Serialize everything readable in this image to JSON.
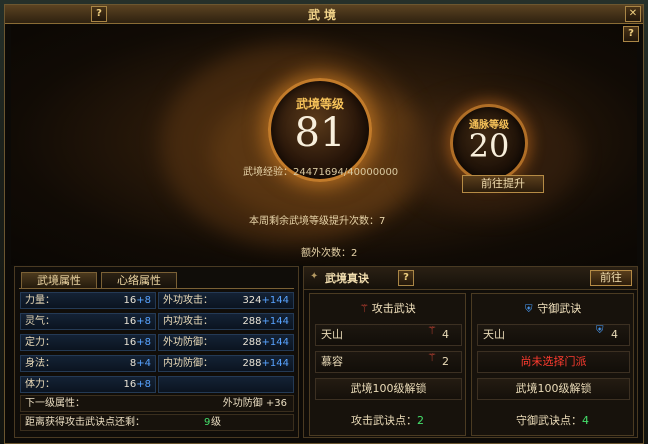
{
  "window": {
    "title": "武境",
    "help": "?",
    "close": "✕"
  },
  "outer_help": "?",
  "level": {
    "title": "武境等级",
    "value": "81"
  },
  "meridian": {
    "title": "通脉等级",
    "value": "20"
  },
  "exp": {
    "label": "武境经验：",
    "value": "24471694/40000000"
  },
  "goto_upgrade": "前往提升",
  "weekly": {
    "label": "本周剩余武境等级提升次数：",
    "value": "7"
  },
  "extra": {
    "label": "额外次数：",
    "value": "2"
  },
  "tabs": {
    "attr": "武境属性",
    "meridian": "心络属性"
  },
  "attributes": [
    {
      "name": "力量：",
      "base": "16",
      "plus": "+8",
      "name2": "外功攻击：",
      "base2": "324",
      "plus2": "+144"
    },
    {
      "name": "灵气：",
      "base": "16",
      "plus": "+8",
      "name2": "内功攻击：",
      "base2": "288",
      "plus2": "+144"
    },
    {
      "name": "定力：",
      "base": "16",
      "plus": "+8",
      "name2": "外功防御：",
      "base2": "288",
      "plus2": "+144"
    },
    {
      "name": "身法：",
      "base": "8",
      "plus": "+4",
      "name2": "内功防御：",
      "base2": "288",
      "plus2": "+144"
    },
    {
      "name": "体力：",
      "base": "16",
      "plus": "+8"
    }
  ],
  "next_level": {
    "label": "下一级属性：",
    "value": "外功防御 +36"
  },
  "distance": {
    "label": "距离获得攻击武诀点还剩：",
    "num": "9",
    "unit": "级"
  },
  "right": {
    "title": "武境真诀",
    "help": "?",
    "goto": "前往",
    "attack": {
      "title": "攻击武诀",
      "items": [
        {
          "name": "天山",
          "count": "4"
        },
        {
          "name": "慕容",
          "count": "2"
        }
      ],
      "unlock": "武境100级解锁",
      "points_label": "攻击武诀点：",
      "points": "2"
    },
    "defense": {
      "title": "守御武诀",
      "items": [
        {
          "name": "天山",
          "count": "4"
        }
      ],
      "unselected": "尚未选择门派",
      "unlock": "武境100级解锁",
      "points_label": "守御武诀点：",
      "points": "4"
    }
  },
  "colors": {
    "gold": "#f7c35a",
    "plus_blue": "#58a3ff",
    "warning_red": "#ff3b2f",
    "points_green": "#44e06b"
  }
}
